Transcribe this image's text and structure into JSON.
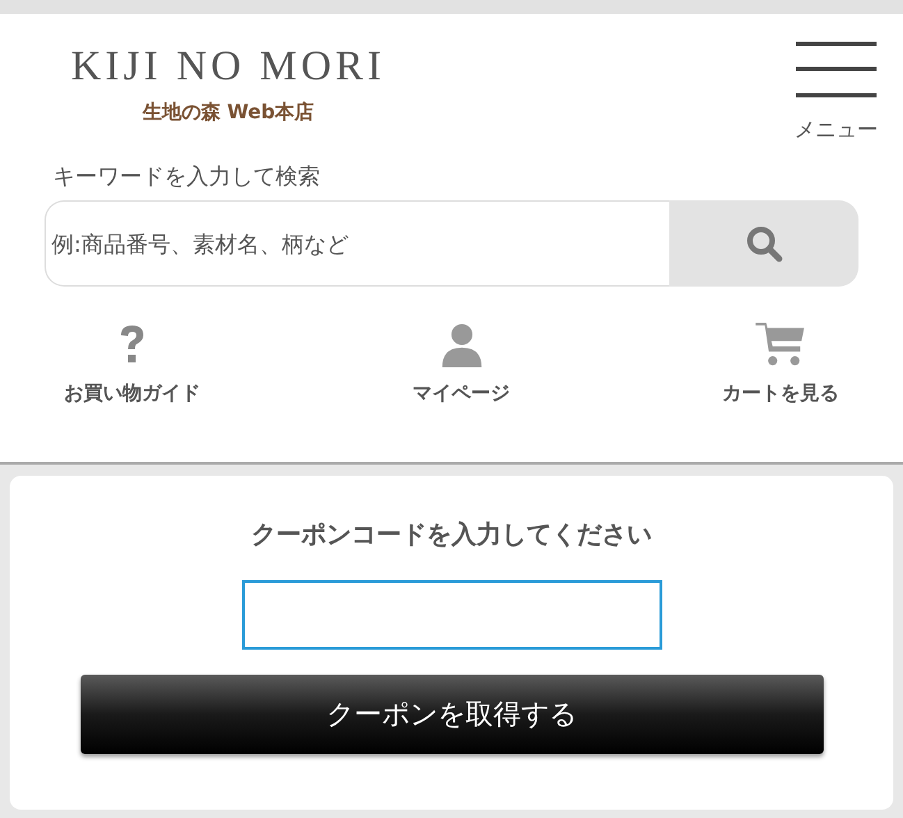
{
  "header": {
    "logo": "KIJI NO MORI",
    "tagline": "生地の森 Web本店",
    "menu_label": "メニュー"
  },
  "search": {
    "label": "キーワードを入力して検索",
    "placeholder": "例:商品番号、素材名、柄など"
  },
  "nav": [
    {
      "kind": "help",
      "label": "お買い物ガイド"
    },
    {
      "kind": "user",
      "label": "マイページ"
    },
    {
      "kind": "cart",
      "label": "カートを見る"
    }
  ],
  "coupon": {
    "title": "クーポンコードを入力してください",
    "button": "クーポンを取得する"
  }
}
